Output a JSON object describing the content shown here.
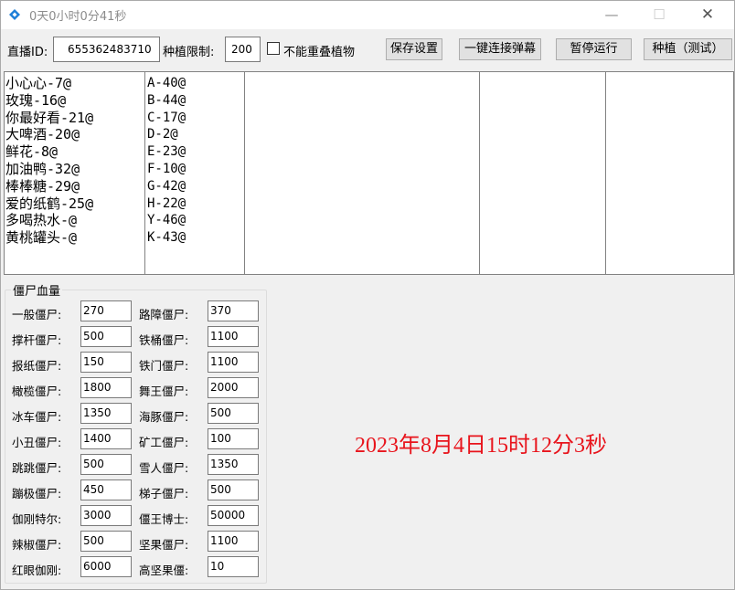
{
  "window": {
    "title": "0天0小时0分41秒",
    "minimize_glyph": "—",
    "maximize_glyph": "☐",
    "close_glyph": "✕",
    "icon": "diamond-app-icon",
    "icon_color": "#1e7fd8"
  },
  "toolbar": {
    "live_id_label": "直播ID:",
    "live_id_value": "655362483710",
    "plant_limit_label": "种植限制:",
    "plant_limit_value": "200",
    "no_overlap_label": "不能重叠植物",
    "no_overlap_checked": false,
    "save_button": "保存设置",
    "connect_button": "一键连接弹幕",
    "pause_button": "暂停运行",
    "plant_test_button": "种植（测试）"
  },
  "lists": {
    "gifts": [
      "小心心-7@",
      "玫瑰-16@",
      "你最好看-21@",
      "大啤酒-20@",
      "鲜花-8@",
      "加油鸭-32@",
      "棒棒糖-29@",
      "爱的纸鹤-25@",
      "多喝热水-@",
      "黄桃罐头-@"
    ],
    "keys": [
      "A-40@",
      "B-44@",
      "C-17@",
      "D-2@",
      "E-23@",
      "F-10@",
      "G-42@",
      "H-22@",
      "Y-46@",
      "K-43@"
    ]
  },
  "zombie_hp": {
    "title": "僵尸血量",
    "left": [
      {
        "label": "一般僵尸:",
        "value": "270"
      },
      {
        "label": "撑杆僵尸:",
        "value": "500"
      },
      {
        "label": "报纸僵尸:",
        "value": "150"
      },
      {
        "label": "橄榄僵尸:",
        "value": "1800"
      },
      {
        "label": "冰车僵尸:",
        "value": "1350"
      },
      {
        "label": "小丑僵尸:",
        "value": "1400"
      },
      {
        "label": "跳跳僵尸:",
        "value": "500"
      },
      {
        "label": "蹦极僵尸:",
        "value": "450"
      },
      {
        "label": "伽刚特尔:",
        "value": "3000"
      },
      {
        "label": "辣椒僵尸:",
        "value": "500"
      },
      {
        "label": "红眼伽刚:",
        "value": "6000"
      }
    ],
    "right": [
      {
        "label": "路障僵尸:",
        "value": "370"
      },
      {
        "label": "铁桶僵尸:",
        "value": "1100"
      },
      {
        "label": "铁门僵尸:",
        "value": "1100"
      },
      {
        "label": "舞王僵尸:",
        "value": "2000"
      },
      {
        "label": "海豚僵尸:",
        "value": "500"
      },
      {
        "label": "矿工僵尸:",
        "value": "100"
      },
      {
        "label": "雪人僵尸:",
        "value": "1350"
      },
      {
        "label": "梯子僵尸:",
        "value": "500"
      },
      {
        "label": "僵王博士:",
        "value": "50000"
      },
      {
        "label": "坚果僵尸:",
        "value": "1100"
      },
      {
        "label": "高坚果僵:",
        "value": "10"
      }
    ]
  },
  "datetime": {
    "text": "2023年8月4日15时12分3秒",
    "color": "#e8141c"
  }
}
